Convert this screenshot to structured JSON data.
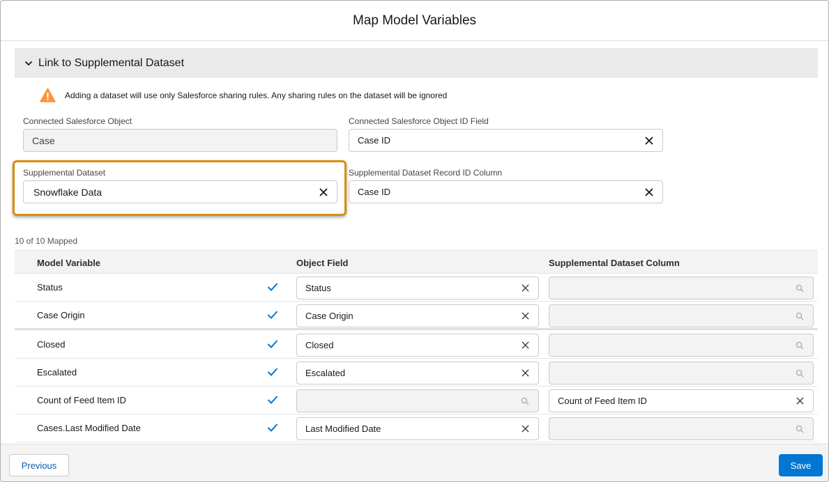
{
  "header": {
    "title": "Map Model Variables"
  },
  "section": {
    "title": "Link to Supplemental Dataset"
  },
  "warning": {
    "text": "Adding a dataset will use only Salesforce sharing rules. Any sharing rules on the dataset will be ignored"
  },
  "fields": {
    "connected_object": {
      "label": "Connected Salesforce Object",
      "value": "Case"
    },
    "connected_object_id": {
      "label": "Connected Salesforce Object ID Field",
      "value": "Case ID"
    },
    "supplemental_dataset": {
      "label": "Supplemental Dataset",
      "value": "Snowflake Data"
    },
    "supplemental_record_id": {
      "label": "Supplemental Dataset Record ID Column",
      "value": "Case ID"
    }
  },
  "mapped_count": "10 of 10 Mapped",
  "table": {
    "columns": [
      "Model Variable",
      "Object Field",
      "Supplemental Dataset Column"
    ],
    "rows": [
      {
        "model_variable": "Status",
        "object_field": "Status",
        "dataset_column": ""
      },
      {
        "model_variable": "Case Origin",
        "object_field": "Case Origin",
        "dataset_column": ""
      },
      {
        "model_variable": "Closed",
        "object_field": "Closed",
        "dataset_column": ""
      },
      {
        "model_variable": "Escalated",
        "object_field": "Escalated",
        "dataset_column": ""
      },
      {
        "model_variable": "Count of Feed Item ID",
        "object_field": "",
        "dataset_column": "Count of Feed Item ID"
      },
      {
        "model_variable": "Cases.Last Modified Date",
        "object_field": "Last Modified Date",
        "dataset_column": ""
      }
    ]
  },
  "footer": {
    "previous_label": "Previous",
    "save_label": "Save"
  },
  "colors": {
    "accent": "#0176d3",
    "highlight": "#d98c0c",
    "warning": "#fe9339",
    "check": "#0176d3"
  }
}
